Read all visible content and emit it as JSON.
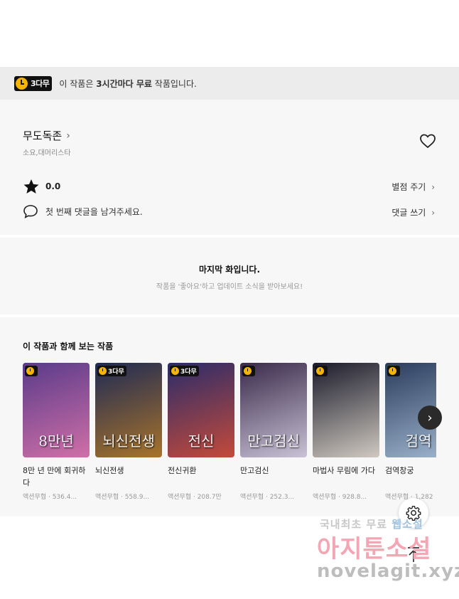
{
  "notice": {
    "badge": "3다무",
    "text_pre": "이 작품은 ",
    "text_bold": "3시간마다 무료",
    "text_post": " 작품입니다."
  },
  "work": {
    "title": "무도독존",
    "authors": "소요,대머리스타",
    "rating": "0.0",
    "rate_link": "별점 주기",
    "comment_prompt": "첫 번째 댓글을 남겨주세요.",
    "comment_link": "댓글 쓰기"
  },
  "last_episode": {
    "title": "마지막 화입니다.",
    "subtitle": "작품을 '좋아요'하고 업데이트 소식을 받아보세요!"
  },
  "recommendations": {
    "title": "이 작품과 함께 보는 작품",
    "items": [
      {
        "title": "8만 년 만에 회귀하다",
        "meta": "액션무협 · 536.4...",
        "badge": "",
        "art": "8만년",
        "colors": [
          "#5a3b8a",
          "#d06fa7"
        ]
      },
      {
        "title": "뇌신전생",
        "meta": "액션무협 · 558.9...",
        "badge": "3다무",
        "art": "뇌신전생",
        "colors": [
          "#1f2a55",
          "#a8732a"
        ]
      },
      {
        "title": "전신귀환",
        "meta": "액션무협 · 208.7만",
        "badge": "3다무",
        "art": "전신",
        "colors": [
          "#2a2c6a",
          "#c44a3a"
        ]
      },
      {
        "title": "만고검신",
        "meta": "액션무협 · 252.3...",
        "badge": "",
        "art": "만고검신",
        "colors": [
          "#3a2a4a",
          "#c9c3d6"
        ]
      },
      {
        "title": "마법사 무림에 가다",
        "meta": "액션무협 · 928.8...",
        "badge": "",
        "art": "",
        "colors": [
          "#1a1a2a",
          "#cfc9c0"
        ]
      },
      {
        "title": "검역창궁",
        "meta": "액션무협 · 1,282",
        "badge": "",
        "art": "검역",
        "colors": [
          "#2b3c5c",
          "#9fb6cf"
        ]
      }
    ]
  },
  "watermark": {
    "line1a": "국내최초 무료",
    "line1b": "웹소설",
    "line2": "아지툰소설",
    "line3": "novelagit.xyz"
  },
  "icons": {
    "heart": "heart-icon",
    "star": "star-icon",
    "comment": "comment-icon",
    "next": "chevron-right-icon",
    "settings": "gear-icon",
    "top": "arrow-up-icon"
  }
}
